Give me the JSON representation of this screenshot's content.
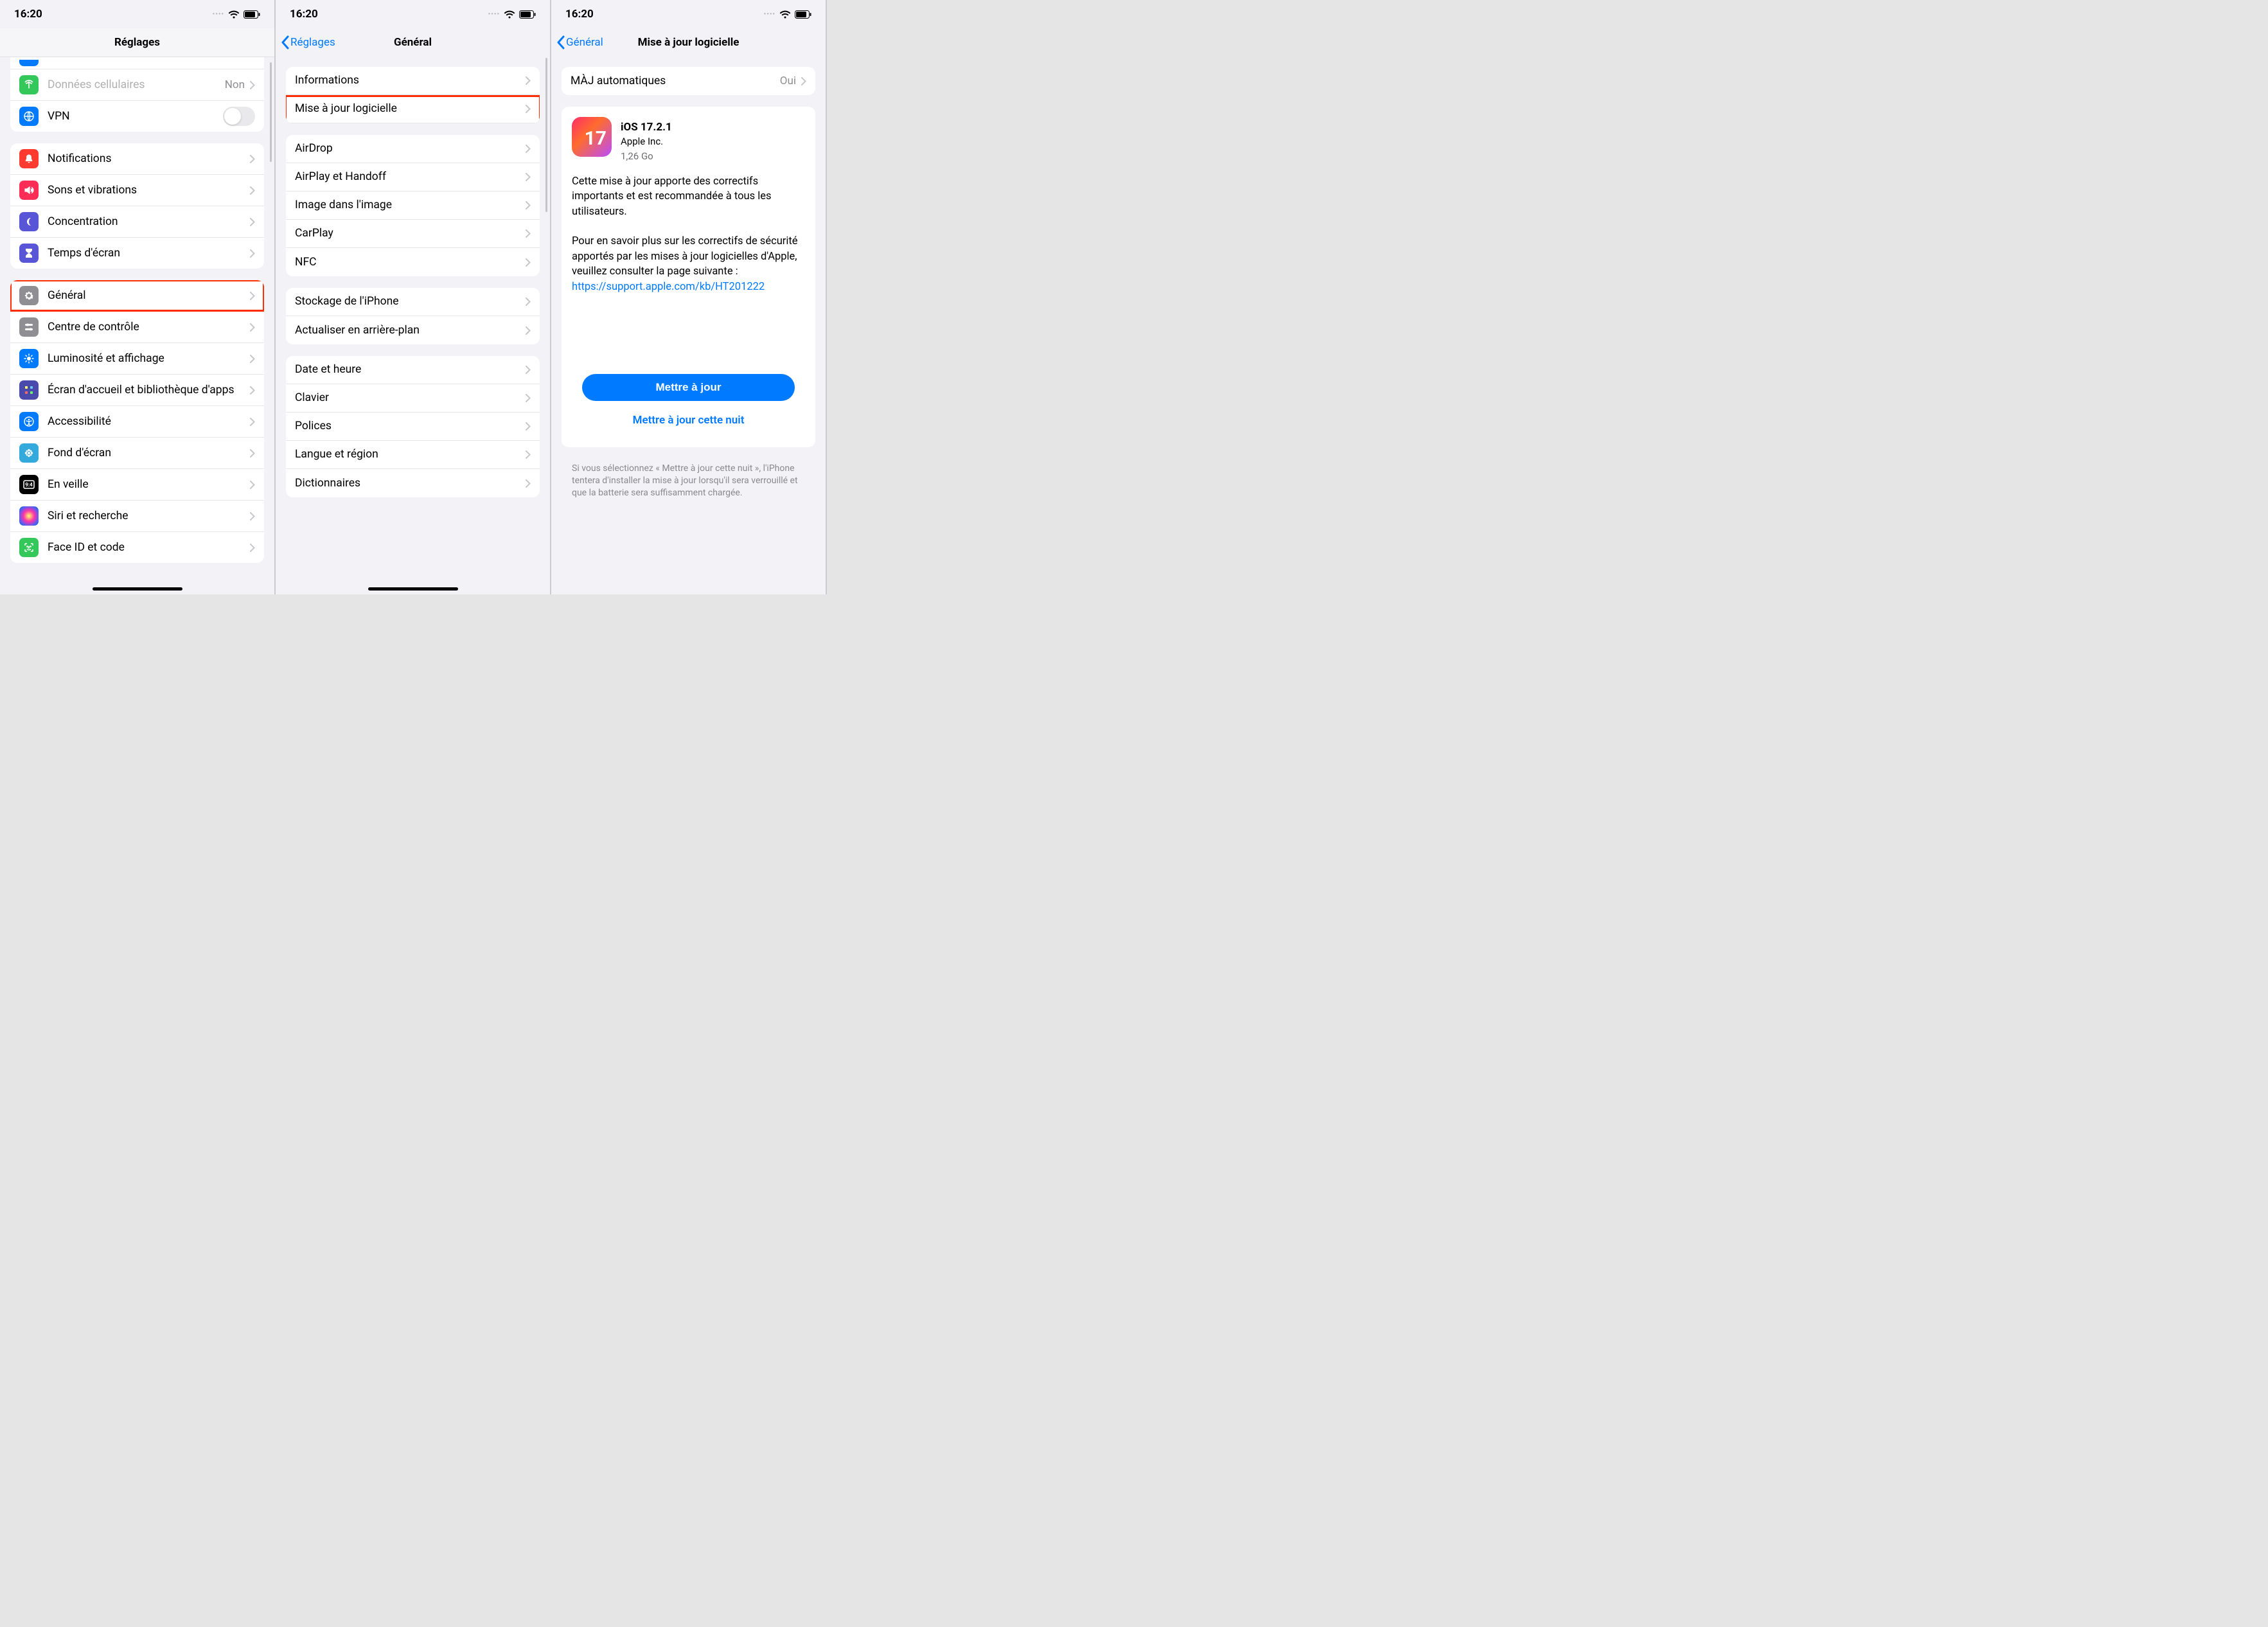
{
  "status": {
    "time": "16:20"
  },
  "phone1": {
    "title": "Réglages",
    "groupA": {
      "cellular": {
        "label": "Données cellulaires",
        "detail": "Non"
      },
      "vpn": {
        "label": "VPN"
      }
    },
    "groupB": {
      "notifications": "Notifications",
      "sounds": "Sons et vibrations",
      "focus": "Concentration",
      "screentime": "Temps d'écran"
    },
    "groupC": {
      "general": "Général",
      "control": "Centre de contrôle",
      "display": "Luminosité et affichage",
      "home": "Écran d'accueil et bibliothèque d'apps",
      "accessibility": "Accessibilité",
      "wallpaper": "Fond d'écran",
      "standby": "En veille",
      "siri": "Siri et recherche",
      "faceid": "Face ID et code"
    }
  },
  "phone2": {
    "back": "Réglages",
    "title": "Général",
    "g1": {
      "info": "Informations",
      "update": "Mise à jour logicielle"
    },
    "g2": {
      "airdrop": "AirDrop",
      "airplay": "AirPlay et Handoff",
      "pip": "Image dans l'image",
      "carplay": "CarPlay",
      "nfc": "NFC"
    },
    "g3": {
      "storage": "Stockage de l'iPhone",
      "background": "Actualiser en arrière-plan"
    },
    "g4": {
      "date": "Date et heure",
      "keyboard": "Clavier",
      "fonts": "Polices",
      "lang": "Langue et région",
      "dict": "Dictionnaires"
    }
  },
  "phone3": {
    "back": "Général",
    "title": "Mise à jour logicielle",
    "auto": {
      "label": "MÀJ automatiques",
      "value": "Oui"
    },
    "update": {
      "badge": "17",
      "version": "iOS 17.2.1",
      "company": "Apple Inc.",
      "size": "1,26 Go",
      "p1": "Cette mise à jour apporte des correctifs importants et est recommandée à tous les utilisateurs.",
      "p2": "Pour en savoir plus sur les correctifs de sécurité apportés par les mises à jour logicielles d'Apple, veuillez consulter la page suivante :",
      "link": "https://support.apple.com/kb/HT201222",
      "btn_now": "Mettre à jour",
      "btn_tonight": "Mettre à jour cette nuit"
    },
    "footnote": "Si vous sélectionnez « Mettre à jour cette nuit », l'iPhone tentera d'installer la mise à jour lorsqu'il sera verrouillé et que la batterie sera suffisamment chargée."
  },
  "colors": {
    "cellular": "#34c759",
    "vpn": "#007aff",
    "notifications": "#ff3b30",
    "sounds": "#ff2d55",
    "focus": "#5856d6",
    "screentime": "#5856d6",
    "general": "#8e8e93",
    "control": "#8e8e93",
    "display": "#007aff",
    "home": "#5856d6",
    "accessibility": "#007aff",
    "wallpaper": "#34aadc",
    "standby": "#000000",
    "siri": "#1c1c1e",
    "faceid": "#34c759"
  }
}
